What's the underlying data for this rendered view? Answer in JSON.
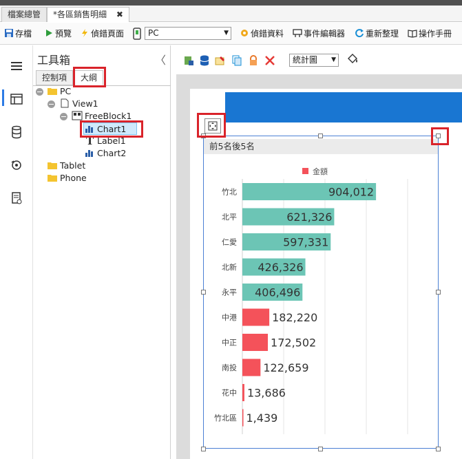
{
  "tabs": [
    {
      "label": "檔案總管"
    },
    {
      "label": "*各區銷售明細",
      "close": "✖"
    }
  ],
  "toolbar": {
    "save": "存檔",
    "preview": "預覽",
    "debug_page": "偵錯頁面",
    "device_select": "PC",
    "debug_data": "偵錯資料",
    "event_editor": "事件編輯器",
    "reorganize": "重新整理",
    "manual": "操作手冊"
  },
  "toolbox": {
    "title": "工具箱",
    "collapse": "〈",
    "tabs": [
      "控制項",
      "大綱"
    ],
    "tree": {
      "pc": "PC",
      "view1": "View1",
      "freeblock1": "FreeBlock1",
      "chart1": "Chart1",
      "label1": "Label1",
      "chart2": "Chart2",
      "tablet": "Tablet",
      "phone": "Phone"
    }
  },
  "workbar": {
    "chart_type_select": "統計圖"
  },
  "chart_data": {
    "type": "bar",
    "orientation": "horizontal",
    "title": "前5名後5名",
    "legend": {
      "label": "金額",
      "placement": "top"
    },
    "categories": [
      "竹北",
      "北平",
      "仁愛",
      "北新",
      "永平",
      "中港",
      "中正",
      "南投",
      "花中",
      "竹北區"
    ],
    "values": [
      904012,
      621326,
      597331,
      426326,
      406496,
      182220,
      172502,
      122659,
      13686,
      1439
    ],
    "value_labels": [
      "904,012",
      "621,326",
      "597,331",
      "426,326",
      "406,496",
      "182,220",
      "172,502",
      "122,659",
      "13,686",
      "1,439"
    ],
    "xlim": [
      0,
      1000000
    ],
    "colors": {
      "top": "#6cc5b5",
      "bottom": "#f4525a",
      "legend": "#f4525a"
    },
    "grid": true
  }
}
